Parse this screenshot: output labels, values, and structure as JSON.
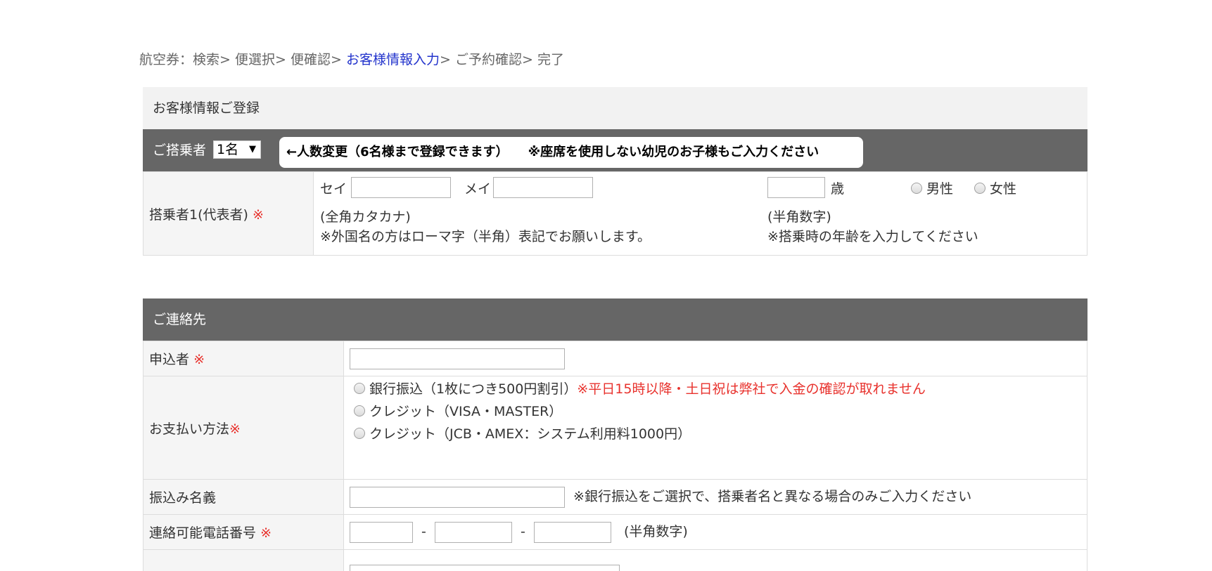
{
  "breadcrumb": {
    "prefix": "航空券：",
    "steps": [
      "検索",
      "便選択",
      "便確認",
      "お客様情報入力",
      "ご予約確認",
      "完了"
    ],
    "separator": "> "
  },
  "passenger_section": {
    "title": "お客様情報ご登録",
    "count_label": "ご搭乗者",
    "count_selected": "1名",
    "notice_change": "←人数変更（6名様まで登録できます）",
    "notice_infant": "※座席を使用しない幼児のお子様もご入力ください",
    "passenger1": {
      "label": "搭乗者1(代表者)",
      "required_mark": "※",
      "sei_label": "セイ",
      "mei_label": "メイ",
      "sei_value": "",
      "mei_value": "",
      "kana_hint": "(全角カタカナ)",
      "foreign_hint": "※外国名の方はローマ字（半角）表記でお願いします。",
      "age_value": "",
      "age_unit": "歳",
      "age_hint": "(半角数字)",
      "age_note": "※搭乗時の年齢を入力してください",
      "gender_male": "男性",
      "gender_female": "女性"
    }
  },
  "contact_section": {
    "title": "ご連絡先",
    "applicant": {
      "label": "申込者",
      "required_mark": "※",
      "value": ""
    },
    "payment": {
      "label": "お支払い方法",
      "required_mark": "※",
      "option_bank": "銀行振込（1枚につき500円割引）",
      "option_bank_note": "※平日15時以降・土日祝は弊社で入金の確認が取れません",
      "option_credit1": "クレジット（VISA・MASTER）",
      "option_credit2": "クレジット（JCB・AMEX：システム利用料1000円）"
    },
    "transfer_name": {
      "label": "振込み名義",
      "value": "",
      "note": "※銀行振込をご選択で、搭乗者名と異なる場合のみご入力ください"
    },
    "phone": {
      "label": "連絡可能電話番号",
      "required_mark": "※",
      "dash": "-",
      "hint": "(半角数字)"
    }
  }
}
